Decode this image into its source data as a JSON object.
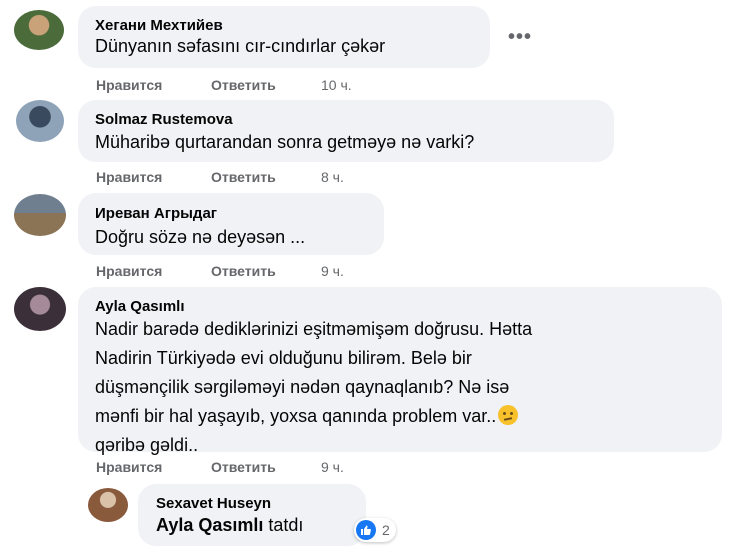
{
  "comments": [
    {
      "author": "Хегани Мехтийев",
      "text": "Dünyanın səfasını cır-cındırlar çəkər",
      "actions": {
        "like": "Нравится",
        "reply": "Ответить",
        "time": "10 ч."
      },
      "avatar_colors": [
        "#4b6b3a",
        "#c9a27a"
      ]
    },
    {
      "author": "Solmaz Rustemova",
      "text": "Müharibə qurtarandan sonra getməyə nə varki?",
      "actions": {
        "like": "Нравится",
        "reply": "Ответить",
        "time": "8 ч."
      },
      "avatar_colors": [
        "#8fa3b8",
        "#3a4a5e"
      ]
    },
    {
      "author": "Иреван Агрыдаг",
      "text": "Doğru sözə nə deyəsən ...",
      "actions": {
        "like": "Нравится",
        "reply": "Ответить",
        "time": "9 ч."
      },
      "avatar_colors": [
        "#6f7f8f",
        "#8b7355"
      ]
    },
    {
      "author": "Ayla Qasımlı",
      "lines": [
        "Nadir barədə dediklərinizi eşitməmişəm doğrusu. Hətta",
        "Nadirin Türkiyədə evi olduğunu bilirəm. Belə bir",
        "düşmənçilik sərgiləməyi nədən qaynaqlanıb? Nə isə",
        "mənfi bir hal yaşayıb, yoxsa qanında problem var..",
        "qəribə gəldi.."
      ],
      "actions": {
        "like": "Нравится",
        "reply": "Ответить",
        "time": "9 ч."
      },
      "avatar_colors": [
        "#3b2f3a",
        "#a58a9a"
      ]
    }
  ],
  "reply": {
    "author": "Sexavet Huseyn",
    "mention": "Ayla Qasımlı",
    "text": " tatdı",
    "reaction_count": "2",
    "avatar_colors": [
      "#8a5a3c",
      "#d9c2a8"
    ]
  },
  "more_label": "•••",
  "colors": {
    "bubble": "#f0f2f5",
    "meta": "#65676b",
    "like": "#1877f2"
  }
}
